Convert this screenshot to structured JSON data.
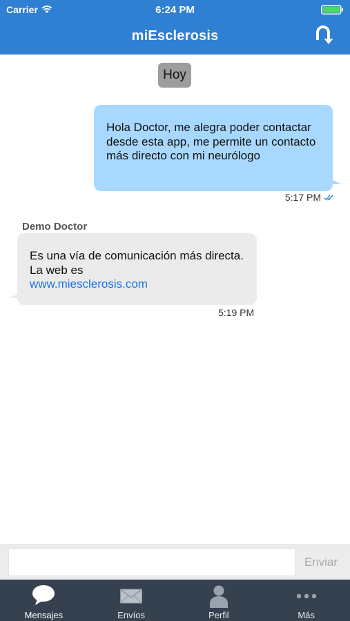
{
  "status_bar": {
    "carrier": "Carrier",
    "time": "6:24 PM"
  },
  "nav": {
    "title": "miEsclerosis",
    "action_icon": "logout-uturn-icon"
  },
  "chat": {
    "date_label": "Hoy",
    "messages": [
      {
        "direction": "outgoing",
        "text": "Hola Doctor, me alegra poder contactar desde esta app, me permite un contacto más directo con mi neurólogo",
        "time": "5:17 PM",
        "status": "read"
      },
      {
        "direction": "incoming",
        "sender": "Demo Doctor",
        "text": "Es una vía de comunicación más directa. La web es",
        "link": "www.miesclerosis.com",
        "time": "5:19 PM"
      }
    ]
  },
  "composer": {
    "placeholder": "",
    "send_label": "Enviar"
  },
  "tabbar": {
    "tabs": [
      {
        "label": "Mensajes",
        "icon": "chat-bubble-icon",
        "active": true
      },
      {
        "label": "Envíos",
        "icon": "envelope-icon",
        "active": false
      },
      {
        "label": "Perfil",
        "icon": "person-icon",
        "active": false
      },
      {
        "label": "Más",
        "icon": "more-dots-icon",
        "active": false
      }
    ]
  },
  "colors": {
    "nav": "#2f7fd2",
    "outgoing_bubble": "#a8d8ff",
    "incoming_bubble": "#ebebeb",
    "tabbar": "#35414f",
    "link": "#1a73e8"
  }
}
